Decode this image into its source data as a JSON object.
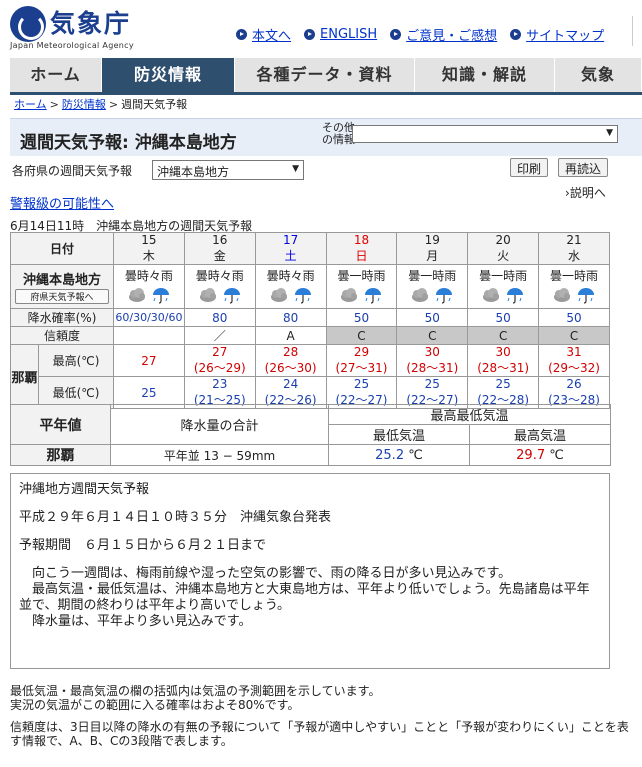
{
  "header": {
    "logo_jp": "気象庁",
    "logo_en": "Japan Meteorological Agency",
    "links": [
      "本文へ",
      "ENGLISH",
      "ご意見・ご感想",
      "サイトマップ"
    ]
  },
  "nav": {
    "tabs": [
      "ホーム",
      "防災情報",
      "各種データ・資料",
      "知識・解説",
      "気象"
    ],
    "active": "防災情報"
  },
  "breadcrumb": [
    "ホーム",
    "防災情報",
    "週間天気予報"
  ],
  "title": {
    "text": "週間天気予報: 沖縄本島地方",
    "other_label_1": "その他",
    "other_label_2": "の情報"
  },
  "pref": {
    "label": "各府県の週間天気予報",
    "selected": "沖縄本島地方",
    "print_button": "印刷",
    "reload_button": "再読込"
  },
  "links": {
    "possible": "警報級の可能性へ",
    "explain": "説明へ"
  },
  "caption": "6月14日11時　沖縄本島地方の週間天気予報",
  "forecast": {
    "date_label": "日付",
    "region_label": "沖縄本島地方",
    "pref_button": "府県天気予報へ",
    "pop_label": "降水確率(%)",
    "reliability_label": "信頼度",
    "city": "那覇",
    "max_label": "最高(℃)",
    "min_label": "最低(℃)",
    "days": [
      {
        "date": "15",
        "dow": "木",
        "type": "weekday",
        "weather": "曇時々雨",
        "pop": "60/30/30/60",
        "rel": "",
        "max": "27",
        "max_range": "",
        "min": "25",
        "min_range": ""
      },
      {
        "date": "16",
        "dow": "金",
        "type": "weekday",
        "weather": "曇時々雨",
        "pop": "80",
        "rel": "／",
        "max": "27",
        "max_range": "(26〜29)",
        "min": "23",
        "min_range": "(21〜25)"
      },
      {
        "date": "17",
        "dow": "土",
        "type": "sat",
        "weather": "曇時々雨",
        "pop": "80",
        "rel": "A",
        "max": "28",
        "max_range": "(26〜30)",
        "min": "24",
        "min_range": "(22〜26)"
      },
      {
        "date": "18",
        "dow": "日",
        "type": "sun",
        "weather": "曇一時雨",
        "pop": "50",
        "rel": "C",
        "max": "29",
        "max_range": "(27〜31)",
        "min": "25",
        "min_range": "(22〜27)"
      },
      {
        "date": "19",
        "dow": "月",
        "type": "weekday",
        "weather": "曇一時雨",
        "pop": "50",
        "rel": "C",
        "max": "30",
        "max_range": "(28〜31)",
        "min": "25",
        "min_range": "(22〜27)"
      },
      {
        "date": "20",
        "dow": "火",
        "type": "weekday",
        "weather": "曇一時雨",
        "pop": "50",
        "rel": "C",
        "max": "30",
        "max_range": "(28〜31)",
        "min": "25",
        "min_range": "(22〜28)"
      },
      {
        "date": "21",
        "dow": "水",
        "type": "weekday",
        "weather": "曇一時雨",
        "pop": "50",
        "rel": "C",
        "max": "31",
        "max_range": "(29〜32)",
        "min": "26",
        "min_range": "(23〜28)"
      }
    ]
  },
  "normals": {
    "header": "平年値",
    "precip_header": "降水量の合計",
    "temp_header": "最高最低気温",
    "min_header": "最低気温",
    "max_header": "最高気温",
    "city": "那覇",
    "precip_value": "平年並 13 − 59mm",
    "min_value": "25.2",
    "max_value": "29.7",
    "unit": "℃"
  },
  "text": {
    "title": "沖縄地方週間天気予報",
    "issued": "平成２９年６月１４日１０時３５分　沖縄気象台発表",
    "period": "予報期間　６月１５日から６月２１日まで",
    "body": [
      "　向こう一週間は、梅雨前線や湿った空気の影響で、雨の降る日が多い見込みです。",
      "　最高気温・最低気温は、沖縄本島地方と大東島地方は、平年より低いでしょう。先島諸島は平年並で、期間の終わりは平年より高いでしょう。",
      "　降水量は、平年より多い見込みです。"
    ]
  },
  "notes": [
    "最低気温・最高気温の欄の括弧内は気温の予測範囲を示しています。",
    "実況の気温がこの範囲に入る確率はおよそ80%です。",
    "信頼度は、3日目以降の降水の有無の予報について「予報が適中しやすい」ことと「予報が変わりにくい」ことを表す情報で、A、B、Cの3段階で表します。"
  ],
  "colors": {
    "brand": "#1b3e8f",
    "nav_active": "#2f4f6f",
    "sunday": "#e00000",
    "saturday": "#0000e0",
    "max_temp": "#d00000",
    "min_temp": "#1a3fb0"
  },
  "icons": [
    "cloud-icon",
    "umbrella-icon"
  ]
}
